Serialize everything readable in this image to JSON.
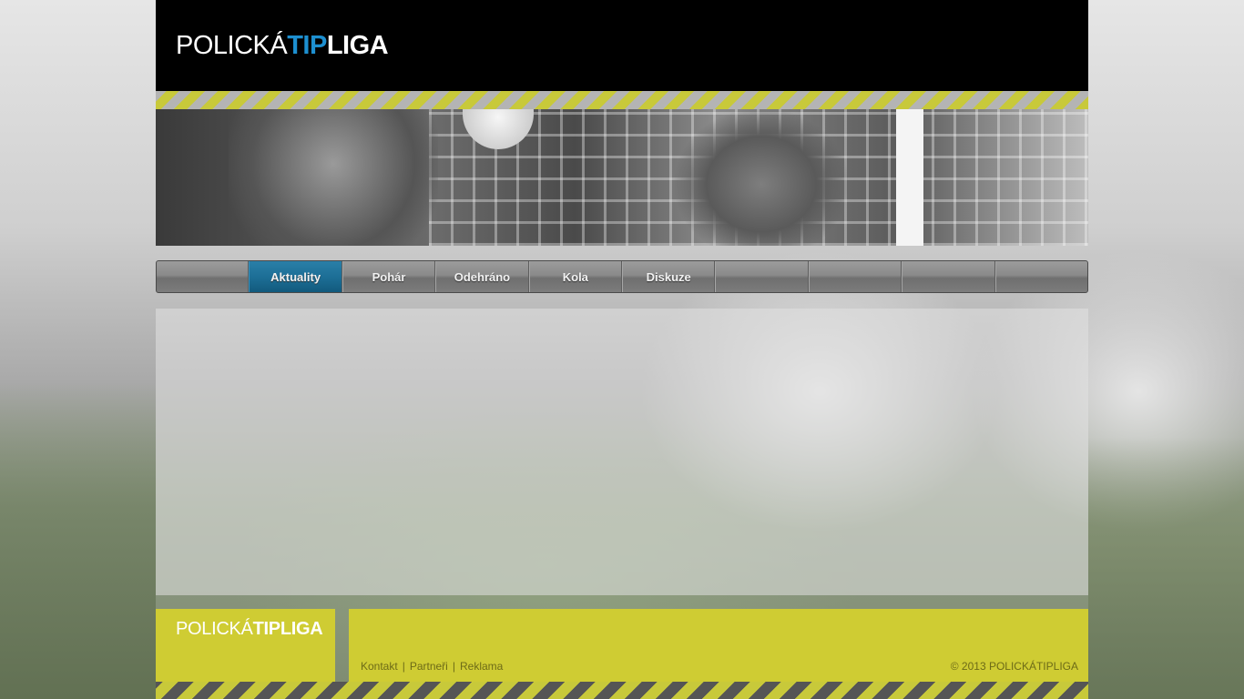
{
  "header": {
    "logo_part1": "POLICKÁ",
    "logo_part2": "TIP",
    "logo_part3": "LIGA"
  },
  "nav": {
    "items": [
      {
        "label": "Aktuality",
        "active": true
      },
      {
        "label": "Pohár",
        "active": false
      },
      {
        "label": "Odehráno",
        "active": false
      },
      {
        "label": "Kola",
        "active": false
      },
      {
        "label": "Diskuze",
        "active": false
      }
    ]
  },
  "footer": {
    "logo_part1": "POLICKÁ",
    "logo_part2": "TIPLIGA",
    "links": [
      "Kontakt",
      "Partneři",
      "Reklama"
    ],
    "separator": "|",
    "copyright": "© 2013 POLICKÁTIPLIGA"
  },
  "colors": {
    "accent_blue": "#1d8fd0",
    "accent_yellow": "#cfcc33",
    "header_bg": "#000000"
  }
}
